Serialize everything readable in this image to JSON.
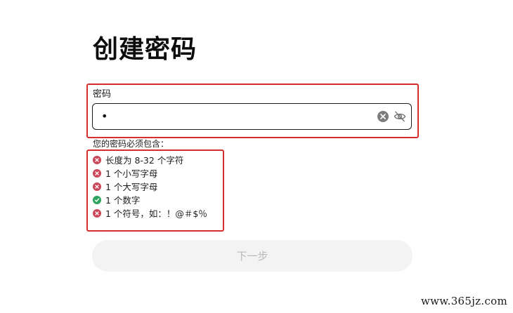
{
  "page": {
    "title": "创建密码"
  },
  "password_field": {
    "label": "密码",
    "value": "•",
    "clear_icon": "clear-circle-icon",
    "visibility_icon": "eye-slash-icon"
  },
  "requirements": {
    "title": "您的密码必须包含：",
    "items": [
      {
        "label": "长度为 8-32 个字符",
        "status": "fail"
      },
      {
        "label": "1 个小写字母",
        "status": "fail"
      },
      {
        "label": "1 个大写字母",
        "status": "fail"
      },
      {
        "label": "1 个数字",
        "status": "pass"
      },
      {
        "label": "1 个符号，如：！@＃$％",
        "status": "fail"
      }
    ]
  },
  "next_button": {
    "label": "下一步",
    "enabled": false
  },
  "watermark": "www.365jz.com",
  "colors": {
    "highlight_border": "#d62e2e",
    "fail": "#c9485a",
    "pass": "#2fa45e",
    "button_bg_disabled": "#f3f3f3",
    "button_text_disabled": "#b9b9b9"
  }
}
